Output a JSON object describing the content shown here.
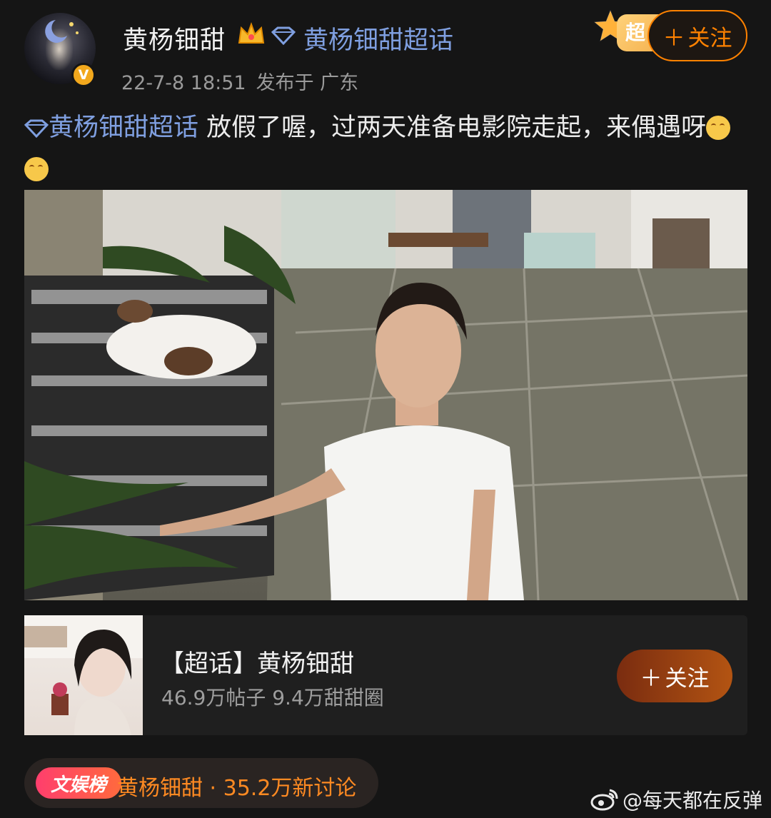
{
  "post": {
    "author": "黄杨钿甜",
    "super_topic": "黄杨钿甜超话",
    "date": "22-7-8 18:51",
    "location": "发布于 广东",
    "follow_label": "关注",
    "super_badge": "超",
    "text_topic": "黄杨钿甜超话",
    "text_body": "放假了喔，过两天准备电影院走起，来偶遇呀"
  },
  "topic_card": {
    "title": "【超话】黄杨钿甜",
    "stats": "46.9万帖子  9.4万甜甜圈",
    "follow_label": "关注"
  },
  "hot": {
    "badge": "文娱榜",
    "text": "黄杨钿甜 · 35.2万新讨论"
  },
  "watermark": "@每天都在反弹",
  "colors": {
    "background": "#151515",
    "link": "#7f9fe0",
    "accent": "#ff8200",
    "verified": "#f2a81d"
  },
  "icons": [
    "crown-icon",
    "diamond-icon",
    "verified-icon",
    "plus-icon",
    "smile-emoji",
    "weibo-logo-icon"
  ]
}
